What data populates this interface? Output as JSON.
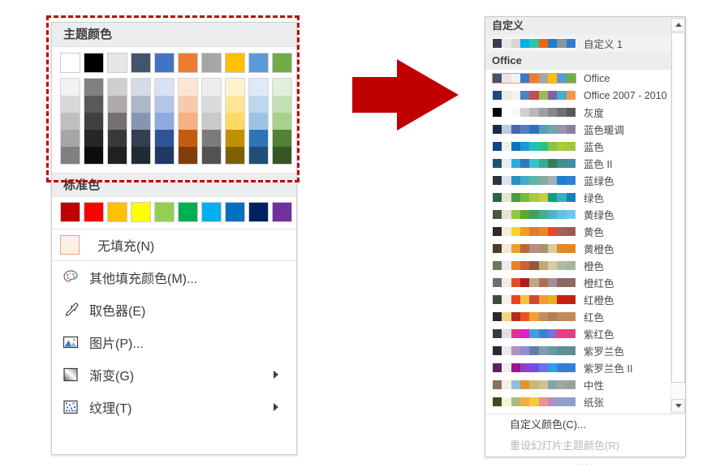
{
  "fill_menu": {
    "theme_section_title": "主题颜色",
    "standard_section_title": "标准色",
    "theme_base_colors": [
      "#ffffff",
      "#000000",
      "#e7e6e6",
      "#44546a",
      "#4472c4",
      "#ed7d31",
      "#a5a5a5",
      "#ffc000",
      "#5b9bd5",
      "#70ad47"
    ],
    "theme_variant_columns": [
      [
        "#f2f2f2",
        "#d8d8d8",
        "#bfbfbf",
        "#a6a6a6",
        "#808080"
      ],
      [
        "#808080",
        "#595959",
        "#404040",
        "#262626",
        "#0d0d0d"
      ],
      [
        "#d0cece",
        "#aeaaaa",
        "#757171",
        "#3b3838",
        "#222020"
      ],
      [
        "#d6dce5",
        "#adb9ca",
        "#8496b0",
        "#333f50",
        "#222a35"
      ],
      [
        "#d9e2f3",
        "#b4c6e7",
        "#8faadc",
        "#2f5496",
        "#1f3864"
      ],
      [
        "#fbe5d6",
        "#f7caac",
        "#f4b183",
        "#c55a11",
        "#833c0c"
      ],
      [
        "#ededed",
        "#dbdbdb",
        "#c9c9c9",
        "#7b7b7b",
        "#525252"
      ],
      [
        "#fff2cc",
        "#ffe599",
        "#ffd966",
        "#bf9000",
        "#7f6000"
      ],
      [
        "#deebf7",
        "#bdd7ee",
        "#9cc3e5",
        "#2e75b6",
        "#1f4e79"
      ],
      [
        "#e2efd9",
        "#c5e0b4",
        "#a9d18e",
        "#538135",
        "#375623"
      ]
    ],
    "standard_colors": [
      "#c00000",
      "#ff0000",
      "#ffc000",
      "#ffff00",
      "#92d050",
      "#00b050",
      "#00b0f0",
      "#0070c0",
      "#002060",
      "#7030a0"
    ],
    "no_fill_label": "无填充(N)",
    "no_fill_accel": "N",
    "menu_items": [
      {
        "label": "其他填充颜色(M)...",
        "accel": "M",
        "icon": "palette-icon",
        "submenu": false
      },
      {
        "label": "取色器(E)",
        "accel": "E",
        "icon": "eyedropper-icon",
        "submenu": false
      },
      {
        "label": "图片(P)...",
        "accel": "P",
        "icon": "picture-icon",
        "submenu": false
      },
      {
        "label": "渐变(G)",
        "accel": "G",
        "icon": "gradient-icon",
        "submenu": true
      },
      {
        "label": "纹理(T)",
        "accel": "T",
        "icon": "texture-icon",
        "submenu": true
      }
    ]
  },
  "highlight": {
    "color": "#c00000",
    "style": "dashed"
  },
  "arrow": {
    "color": "#c00000",
    "direction": "right"
  },
  "theme_panel": {
    "groups": [
      {
        "title": "自定义",
        "themes": [
          {
            "name": "自定义 1",
            "selected": false,
            "row_highlight": true,
            "colors": [
              "#3b3b4f",
              "#e8e8e8",
              "#d5d5d5",
              "#00b0e8",
              "#2fc3a5",
              "#f2620f",
              "#1b7fc9",
              "#8a93a0",
              "#2f7fd0"
            ]
          }
        ]
      },
      {
        "title": "Office",
        "themes": [
          {
            "name": "Office",
            "selected": true,
            "row_highlight": false,
            "colors": [
              "#44546a",
              "#e7e6e6",
              "#f2f2f2",
              "#4472c4",
              "#ed7d31",
              "#a5a5a5",
              "#ffc000",
              "#5b9bd5",
              "#70ad47"
            ]
          },
          {
            "name": "Office 2007 - 2010",
            "selected": false,
            "row_highlight": false,
            "colors": [
              "#1f497d",
              "#eeece1",
              "#f2f2f2",
              "#4f81bd",
              "#c0504d",
              "#9bbb59",
              "#8064a2",
              "#4bacc6",
              "#f79646"
            ]
          },
          {
            "name": "灰度",
            "selected": false,
            "row_highlight": false,
            "colors": [
              "#000000",
              "#ffffff",
              "#f8f8f8",
              "#d0d0d0",
              "#b8b8b8",
              "#a0a0a0",
              "#888888",
              "#707070",
              "#585858"
            ]
          },
          {
            "name": "蓝色暖调",
            "selected": false,
            "row_highlight": false,
            "colors": [
              "#1a2b4f",
              "#b8cce4",
              "#4a66b0",
              "#4f81bd",
              "#2f6fbf",
              "#5a9bb5",
              "#6fa8a8",
              "#9f8fa8",
              "#8b7f9e"
            ]
          },
          {
            "name": "蓝色",
            "selected": false,
            "row_highlight": false,
            "colors": [
              "#0f4486",
              "#f0f0e8",
              "#1070c0",
              "#1b9ad6",
              "#22bfc0",
              "#2cbf7f",
              "#88c34a",
              "#b0c93a",
              "#9fc93a"
            ]
          },
          {
            "name": "蓝色 II",
            "selected": false,
            "row_highlight": false,
            "colors": [
              "#1c5570",
              "#e8ecef",
              "#25aee0",
              "#2f79c4",
              "#34c3d1",
              "#3aab8f",
              "#2f7f59",
              "#3f8f8f",
              "#3e8fa8"
            ]
          },
          {
            "name": "蓝绿色",
            "selected": false,
            "row_highlight": false,
            "colors": [
              "#2d3345",
              "#dfe4ea",
              "#2b8fc0",
              "#48a8c8",
              "#5fb3a8",
              "#89a8a0",
              "#a0b0b8",
              "#1b7fd0",
              "#2f7fd0"
            ]
          },
          {
            "name": "绿色",
            "selected": false,
            "row_highlight": false,
            "colors": [
              "#2d6049",
              "#e5e3d3",
              "#4f9c3e",
              "#79b83f",
              "#a8c93f",
              "#c8cc47",
              "#0f9f7f",
              "#38b0c0",
              "#1580b8"
            ]
          },
          {
            "name": "黄绿色",
            "selected": false,
            "row_highlight": false,
            "colors": [
              "#46593f",
              "#e6e4d4",
              "#8fc73f",
              "#5aa92f",
              "#3f9f5f",
              "#3fb08f",
              "#4fb0c8",
              "#5fc0e8",
              "#6fcaf0"
            ]
          },
          {
            "name": "黄色",
            "selected": false,
            "row_highlight": false,
            "colors": [
              "#2f2a24",
              "#f0ece0",
              "#ffd320",
              "#f79a1f",
              "#e07b2f",
              "#f2841f",
              "#e84b20",
              "#a4625c",
              "#9c5c50"
            ]
          },
          {
            "name": "黄橙色",
            "selected": false,
            "row_highlight": false,
            "colors": [
              "#4f3a28",
              "#f2e8d4",
              "#e8a030",
              "#b56a3f",
              "#b89080",
              "#a89070",
              "#d8cba0",
              "#e08a20",
              "#dc8a1f"
            ]
          },
          {
            "name": "橙色",
            "selected": false,
            "row_highlight": false,
            "colors": [
              "#6a7a5a",
              "#e8ecf0",
              "#e88420",
              "#d06030",
              "#8f5a3f",
              "#c0a878",
              "#d8cca0",
              "#b0bca0",
              "#a8b49c"
            ]
          },
          {
            "name": "橙红色",
            "selected": false,
            "row_highlight": false,
            "colors": [
              "#6f6f6f",
              "#f0ece4",
              "#e84a20",
              "#b01f20",
              "#c0a48c",
              "#b07050",
              "#a09098",
              "#8a6a62",
              "#8f6a60"
            ]
          },
          {
            "name": "红橙色",
            "selected": false,
            "row_highlight": false,
            "colors": [
              "#3f4a3f",
              "#f4f0e4",
              "#e8441f",
              "#f7c040",
              "#d0492f",
              "#f79a30",
              "#e8b020",
              "#c81f10",
              "#c42010"
            ]
          },
          {
            "name": "红色",
            "selected": false,
            "row_highlight": false,
            "colors": [
              "#2a2a2a",
              "#f0d47f",
              "#b02f24",
              "#e8541f",
              "#f0a030",
              "#c08f60",
              "#b08058",
              "#c08a5c",
              "#bf8a58"
            ]
          },
          {
            "name": "紫红色",
            "selected": false,
            "row_highlight": false,
            "colors": [
              "#3a3a44",
              "#e0e0e0",
              "#e8308f",
              "#e020c8",
              "#3f9fe0",
              "#3f7fd0",
              "#7f6fd8",
              "#e8407f",
              "#e3407e"
            ]
          },
          {
            "name": "紫罗兰色",
            "selected": false,
            "row_highlight": false,
            "colors": [
              "#2b2838",
              "#eceaea",
              "#b08fc8",
              "#8f8fd0",
              "#5f7fa8",
              "#7f9fb0",
              "#5f9fa0",
              "#5f8f98",
              "#5f8f94"
            ]
          },
          {
            "name": "紫罗兰色 II",
            "selected": false,
            "row_highlight": false,
            "colors": [
              "#5e2060",
              "#f0eeec",
              "#a0108f",
              "#9040c8",
              "#6f50e0",
              "#6f70e8",
              "#2f9fe8",
              "#2f7fd8",
              "#3080d8"
            ]
          },
          {
            "name": "中性",
            "selected": false,
            "row_highlight": false,
            "colors": [
              "#8a7060",
              "#f4f0e4",
              "#8fc0d8",
              "#e8922f",
              "#c8b878",
              "#d0c098",
              "#80a8a8",
              "#9fa8a0",
              "#9c9f98"
            ]
          },
          {
            "name": "纸张",
            "selected": false,
            "row_highlight": false,
            "colors": [
              "#3f4a20",
              "#f8f4dc",
              "#a8bc80",
              "#f0b040",
              "#f4c840",
              "#f09090",
              "#b090c8",
              "#8f9fd0",
              "#8fa0cf"
            ]
          }
        ]
      }
    ],
    "footer_items": [
      {
        "label": "自定义颜色(C)...",
        "accel": "C",
        "disabled": false
      },
      {
        "label": "重设幻灯片主题颜色(R)",
        "accel": "R",
        "disabled": true
      }
    ],
    "footer_dots": "...."
  }
}
